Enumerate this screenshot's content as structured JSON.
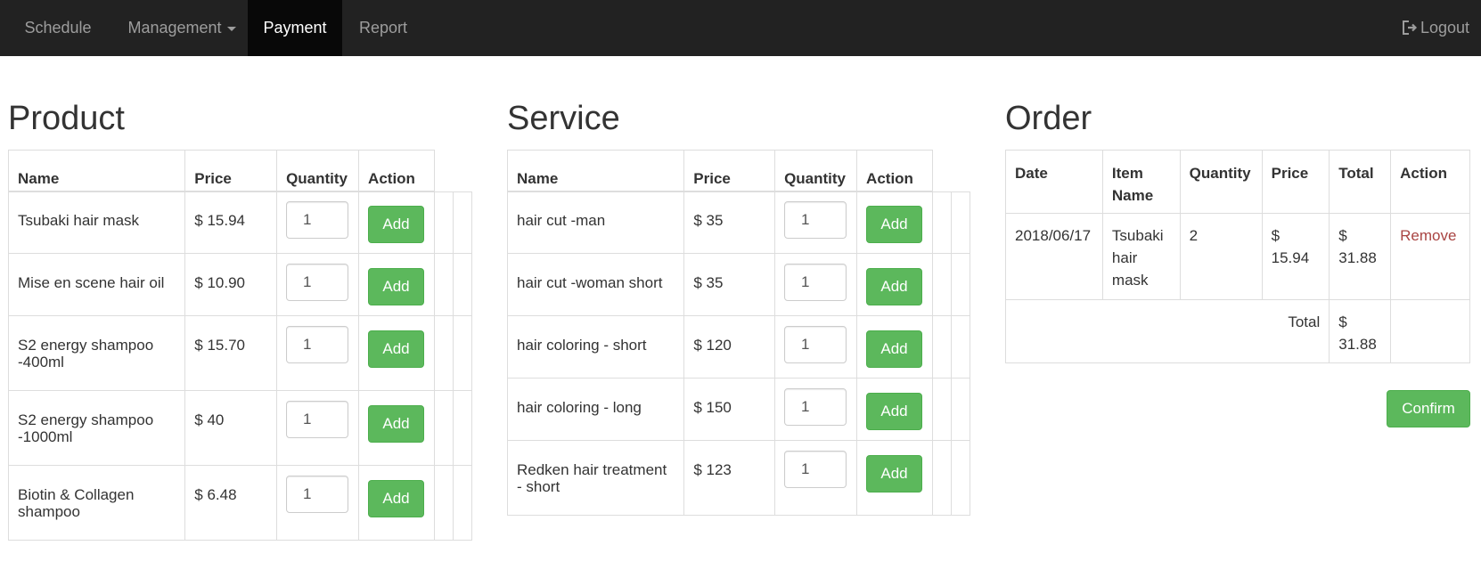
{
  "nav": {
    "items": [
      {
        "label": "Schedule"
      },
      {
        "label": "Management"
      },
      {
        "label": "Payment"
      },
      {
        "label": "Report"
      }
    ],
    "logout_label": "Logout",
    "active": "Payment"
  },
  "product": {
    "title": "Product",
    "headers": [
      "Name",
      "Price",
      "Quantity",
      "Action"
    ],
    "rows": [
      {
        "name": "Tsubaki hair mask",
        "price": "$ 15.94",
        "quantity": "1",
        "action": "Add"
      },
      {
        "name": "Mise en scene hair oil",
        "price": "$ 10.90",
        "quantity": "1",
        "action": "Add"
      },
      {
        "name": "S2 energy shampoo -400ml",
        "price": "$ 15.70",
        "quantity": "1",
        "action": "Add"
      },
      {
        "name": "S2 energy shampoo -1000ml",
        "price": "$ 40",
        "quantity": "1",
        "action": "Add"
      },
      {
        "name": "Biotin & Collagen shampoo",
        "price": "$ 6.48",
        "quantity": "1",
        "action": "Add"
      }
    ]
  },
  "service": {
    "title": "Service",
    "headers": [
      "Name",
      "Price",
      "Quantity",
      "Action"
    ],
    "rows": [
      {
        "name": "hair cut -man",
        "price": "$ 35",
        "quantity": "1",
        "action": "Add"
      },
      {
        "name": "hair cut -woman short",
        "price": "$ 35",
        "quantity": "1",
        "action": "Add"
      },
      {
        "name": "hair coloring - short",
        "price": "$ 120",
        "quantity": "1",
        "action": "Add"
      },
      {
        "name": "hair coloring - long",
        "price": "$ 150",
        "quantity": "1",
        "action": "Add"
      },
      {
        "name": "Redken hair treatment - short",
        "price": "$ 123",
        "quantity": "1",
        "action": "Add"
      }
    ]
  },
  "order": {
    "title": "Order",
    "headers": [
      "Date",
      "Item Name",
      "Quantity",
      "Price",
      "Total",
      "Action"
    ],
    "rows": [
      {
        "date": "2018/06/17",
        "item_name": "Tsubaki hair mask",
        "quantity": "2",
        "price": "$ 15.94",
        "total": "$ 31.88",
        "action": "Remove"
      }
    ],
    "total_label": "Total",
    "total_value": "$ 31.88",
    "confirm_label": "Confirm"
  },
  "colors": {
    "navbar_bg": "#222222",
    "navbar_active_bg": "#080808",
    "success": "#5cb85c",
    "danger_link": "#a94442"
  }
}
